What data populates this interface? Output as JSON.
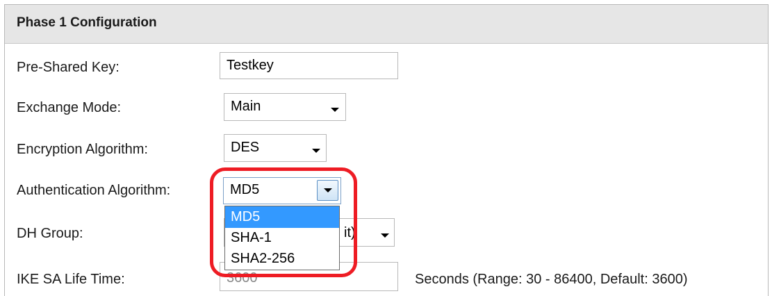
{
  "section": {
    "title": "Phase 1 Configuration"
  },
  "fields": {
    "pre_shared_key": {
      "label": "Pre-Shared Key:",
      "value": "Testkey"
    },
    "exchange_mode": {
      "label": "Exchange Mode:",
      "value": "Main"
    },
    "encryption_algorithm": {
      "label": "Encryption Algorithm:",
      "value": "DES"
    },
    "authentication_algorithm": {
      "label": "Authentication Algorithm:",
      "value": "MD5",
      "options": [
        "MD5",
        "SHA-1",
        "SHA2-256"
      ],
      "highlighted_option": "MD5"
    },
    "dh_group": {
      "label": "DH Group:",
      "value_partial": "it)"
    },
    "ike_sa_life_time": {
      "label": "IKE SA Life Time:",
      "value": "3600",
      "suffix": "Seconds  (Range: 30 - 86400, Default: 3600)"
    }
  },
  "colors": {
    "highlight_ring": "#ee1c24",
    "selected_option_bg": "#3399ff",
    "header_bg": "#e6e6e6"
  }
}
